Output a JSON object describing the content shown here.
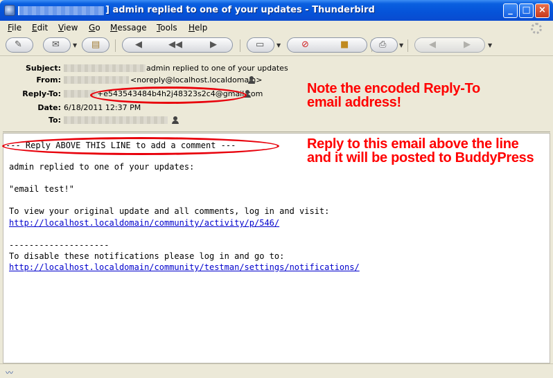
{
  "window": {
    "title": "] admin replied to one of your updates - Thunderbird"
  },
  "menu": {
    "items": [
      {
        "label": "File",
        "key": "F"
      },
      {
        "label": "Edit",
        "key": "E"
      },
      {
        "label": "View",
        "key": "V"
      },
      {
        "label": "Go",
        "key": "G"
      },
      {
        "label": "Message",
        "key": "M"
      },
      {
        "label": "Tools",
        "key": "T"
      },
      {
        "label": "Help",
        "key": "H"
      }
    ]
  },
  "headers": {
    "subject_label": "Subject:",
    "subject_value": "admin replied to one of your updates",
    "from_label": "From:",
    "from_value": "<noreply@localhost.localdomain>",
    "replyto_label": "Reply-To:",
    "replyto_value": "+e543543484b4h2j48323s2c4@gmail.com",
    "date_label": "Date:",
    "date_value": "6/18/2011 12:37 PM",
    "to_label": "To:"
  },
  "body": {
    "reply_line": "--- Reply ABOVE THIS LINE to add a comment ---",
    "intro": "admin replied to one of your updates:",
    "quote": "\"email test!\"",
    "view_text": "To view your original update and all comments, log in and visit:",
    "view_link": "http://localhost.localdomain/community/activity/p/546/",
    "divider": "--------------------",
    "disable_text": "To disable these notifications please log in and go to:",
    "disable_link": "http://localhost.localdomain/community/testman/settings/notifications/"
  },
  "annotations": {
    "note1_line1": "Note the encoded Reply-To",
    "note1_line2": "email address!",
    "note2_line1": "Reply to this email above the line",
    "note2_line2": "and it will be posted to BuddyPress",
    "color": "#ff0000"
  },
  "icons": [
    "app-icon",
    "compose-icon",
    "get-mail-icon",
    "address-book-icon",
    "reply-icon",
    "reply-all-icon",
    "forward-icon",
    "file-icon",
    "delete-icon",
    "junk-icon",
    "print-icon",
    "back-icon",
    "forward-nav-icon",
    "person-icon",
    "throbber-icon"
  ]
}
